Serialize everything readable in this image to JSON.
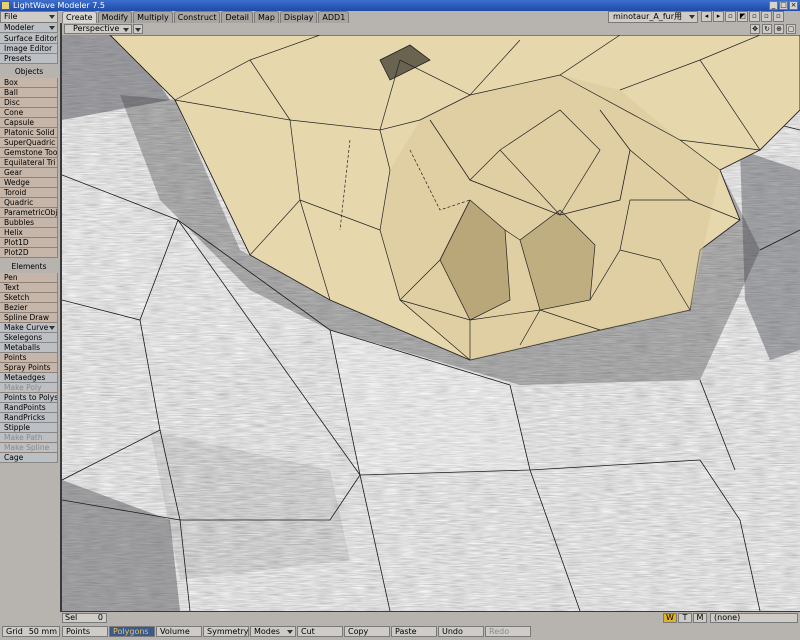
{
  "window": {
    "title": "LightWave Modeler 7.5"
  },
  "menu": {
    "file_label": "File",
    "modeler_label": "Modeler"
  },
  "tabs": [
    "Create",
    "Modify",
    "Multiply",
    "Construct",
    "Detail",
    "Map",
    "Display",
    "ADD1"
  ],
  "active_tab": "Create",
  "document_selector": "minotaur_A_fur用",
  "viewport": {
    "view_type": "Perspective"
  },
  "sidebar": {
    "top_buttons": [
      "Surface Editor",
      "Image Editor",
      "Presets"
    ],
    "objects_header": "Objects",
    "objects": [
      "Box",
      "Ball",
      "Disc",
      "Cone",
      "Capsule",
      "Platonic Solid",
      "SuperQuadric",
      "Gemstone Tool",
      "Equilateral Tri",
      "Gear",
      "Wedge",
      "Toroid",
      "Quadric",
      "ParametricObj",
      "Bubbles",
      "Helix",
      "Plot1D",
      "Plot2D"
    ],
    "elements_header": "Elements",
    "elements": [
      "Pen",
      "Text",
      "Sketch",
      "Bezier",
      "Spline Draw",
      "Make Curve",
      "Skelegons",
      "Metaballs",
      "Points",
      "Spray Points",
      "Metaedges",
      "Make Poly",
      "Points to Polys",
      "RandPoints",
      "RandPricks",
      "Stipple",
      "Make Path",
      "Make Spline",
      "Cage"
    ],
    "disabled_items": [
      "Make Poly",
      "Make Path",
      "Make Spline"
    ]
  },
  "status": {
    "sel_label": "Sel",
    "sel_value": "0",
    "grid_label": "Grid",
    "grid_value": "50 mm",
    "wtm": [
      "W",
      "T",
      "M"
    ],
    "surface_selector": "(none)"
  },
  "bottom_buttons": [
    "Points",
    "Polygons",
    "Volume",
    "Symmetry",
    "Modes",
    "Cut",
    "Copy",
    "Paste",
    "Undo",
    "Redo"
  ],
  "selection_mode": "Polygons",
  "colors": {
    "title_bar": "#2a5cc0",
    "panel": "#b7b4b0",
    "button": "#c6b6a9",
    "model_face": "#e6d7ad",
    "fur": "#a8a8a8"
  }
}
